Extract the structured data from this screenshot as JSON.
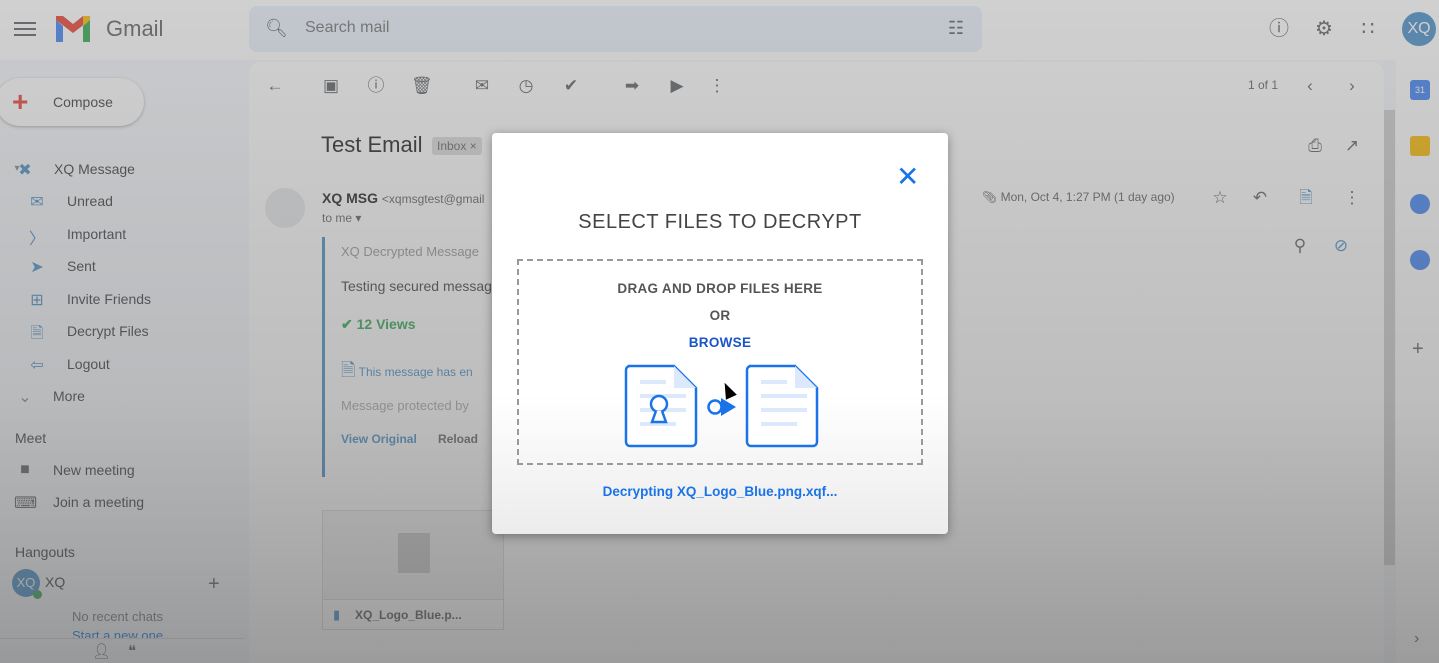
{
  "header": {
    "brand": "Gmail",
    "search_placeholder": "Search mail",
    "avatar_initials": "XQ",
    "icons": [
      "menu-icon",
      "search-icon",
      "tune-icon",
      "help-icon",
      "settings-icon",
      "apps-icon"
    ]
  },
  "sidebar": {
    "compose_label": "Compose",
    "xq_group_label": "XQ Message",
    "xq_items": [
      {
        "label": "Unread",
        "icon": "unread-icon"
      },
      {
        "label": "Important",
        "icon": "important-icon"
      },
      {
        "label": "Sent",
        "icon": "sent-icon"
      },
      {
        "label": "Invite Friends",
        "icon": "invite-icon"
      },
      {
        "label": "Decrypt Files",
        "icon": "decrypt-files-icon"
      },
      {
        "label": "Logout",
        "icon": "logout-icon"
      }
    ],
    "more_label": "More",
    "meet": {
      "title": "Meet",
      "items": [
        {
          "label": "New meeting",
          "icon": "video-icon"
        },
        {
          "label": "Join a meeting",
          "icon": "keyboard-icon"
        }
      ]
    },
    "hangouts": {
      "title": "Hangouts",
      "user_initials": "XQ",
      "user_name": "XQ",
      "no_chats": "No recent chats",
      "start_new": "Start a new one"
    }
  },
  "toolbar": {
    "pagination": "1 of 1"
  },
  "email": {
    "subject": "Test Email",
    "label_chip": "Inbox",
    "sender_name": "XQ MSG",
    "sender_email": "<xqmsgtest@gmail",
    "to_line": "to me",
    "date": "Mon, Oct 4, 1:27 PM (1 day ago)",
    "decrypted_heading": "XQ Decrypted Message",
    "body_text": "Testing secured messag",
    "views": "12 Views",
    "info_text": "This message has en",
    "protected_by": "Message protected by",
    "view_original": "View Original",
    "reload": "Reload",
    "attachment_name": "XQ_Logo_Blue.p..."
  },
  "modal": {
    "title": "SELECT FILES TO DECRYPT",
    "drag_text": "DRAG AND DROP FILES HERE",
    "or_text": "OR",
    "browse_text": "BROWSE",
    "status_text": "Decrypting XQ_Logo_Blue.png.xqf...",
    "accent_color": "#1a73e8"
  }
}
